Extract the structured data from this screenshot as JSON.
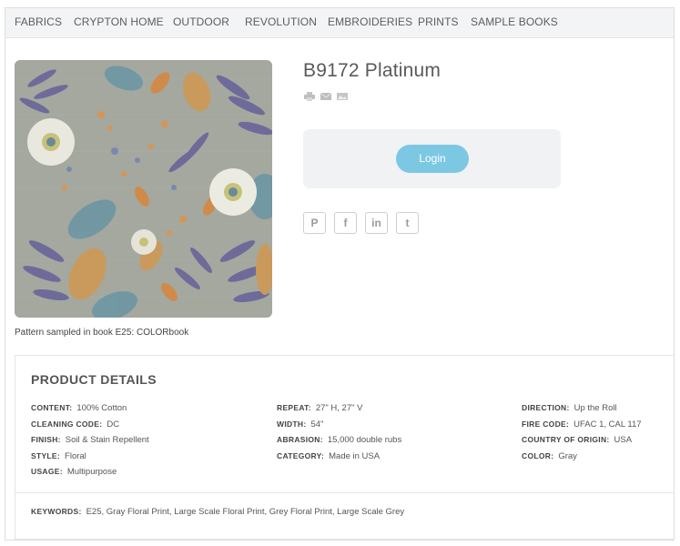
{
  "nav": {
    "items": [
      {
        "label": "FABRICS"
      },
      {
        "label": "CRYPTON HOME"
      },
      {
        "label": "OUTDOOR"
      },
      {
        "label": "REVOLUTION"
      },
      {
        "label": "EMBROIDERIES"
      },
      {
        "label": "PRINTS"
      },
      {
        "label": "SAMPLE BOOKS"
      }
    ]
  },
  "product": {
    "title": "B9172 Platinum",
    "caption": "Pattern sampled in book E25: COLORbook",
    "tools": [
      "print-icon",
      "email-icon",
      "image-icon"
    ]
  },
  "login": {
    "label": "Login"
  },
  "social": {
    "pinterest": "P",
    "facebook": "f",
    "linkedin": "in",
    "twitter": "t"
  },
  "details": {
    "heading": "PRODUCT DETAILS",
    "col1": [
      {
        "label": "CONTENT:",
        "value": "100% Cotton"
      },
      {
        "label": "CLEANING CODE:",
        "value": "DC"
      },
      {
        "label": "FINISH:",
        "value": "Soil & Stain Repellent"
      },
      {
        "label": "STYLE:",
        "value": "Floral"
      },
      {
        "label": "USAGE:",
        "value": "Multipurpose"
      }
    ],
    "col2": [
      {
        "label": "REPEAT:",
        "value": "27\" H, 27\" V"
      },
      {
        "label": "WIDTH:",
        "value": "54\""
      },
      {
        "label": "ABRASION:",
        "value": "15,000 double rubs"
      },
      {
        "label": "CATEGORY:",
        "value": "Made in USA"
      }
    ],
    "col3": [
      {
        "label": "DIRECTION:",
        "value": "Up the Roll"
      },
      {
        "label": "FIRE CODE:",
        "value": "UFAC 1, CAL 117"
      },
      {
        "label": "COUNTRY OF ORIGIN:",
        "value": "USA"
      },
      {
        "label": "COLOR:",
        "value": "Gray"
      }
    ],
    "keywords_label": "KEYWORDS:",
    "keywords": "E25, Gray Floral Print, Large Scale Floral Print, Grey Floral Print, Large Scale Grey"
  },
  "colors": {
    "login_button": "#7cc8e2",
    "nav_bg": "#f3f4f6",
    "swatch_bg": "#a4a89e"
  }
}
